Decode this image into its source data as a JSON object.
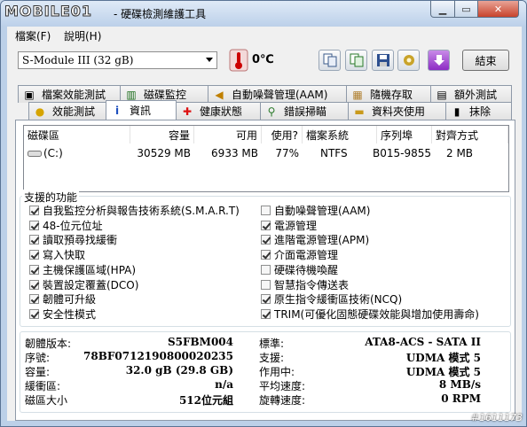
{
  "app": {
    "title": "- 硬碟檢測維護工具",
    "logo": "MOBILE01"
  },
  "menu": [
    "檔案(F)",
    "說明(H)"
  ],
  "toolbar": {
    "drive": "S-Module III        (32 gB)",
    "temperature": "0℃",
    "exit": "結束"
  },
  "tabs_top": [
    "檔案效能測試",
    "磁碟監控",
    "自動噪聲管理(AAM)",
    "隨機存取",
    "額外測試"
  ],
  "tabs_bottom": [
    "效能測試",
    "資訊",
    "健康狀態",
    "錯誤掃瞄",
    "資料夾使用",
    "抹除"
  ],
  "partition_table": {
    "headers": [
      "磁碟區",
      "容量",
      "可用",
      "使用?",
      "檔案系統",
      "序列埠",
      "對齊方式"
    ],
    "row": [
      "(C:)",
      "30529 MB",
      "6933 MB",
      "77%",
      "NTFS",
      "B015-9855",
      "2 MB"
    ]
  },
  "features": {
    "legend": "支援的功能",
    "left": [
      {
        "label": "自我監控分析與報告技術系統(S.M.A.R.T)",
        "checked": true
      },
      {
        "label": "48-位元位址",
        "checked": true
      },
      {
        "label": "讀取預尋找緩衝",
        "checked": true
      },
      {
        "label": "寫入快取",
        "checked": true
      },
      {
        "label": "主機保護區域(HPA)",
        "checked": true
      },
      {
        "label": "裝置設定覆蓋(DCO)",
        "checked": true
      },
      {
        "label": "韌體可升級",
        "checked": true
      },
      {
        "label": "安全性模式",
        "checked": true
      }
    ],
    "right": [
      {
        "label": "自動噪聲管理(AAM)",
        "checked": false
      },
      {
        "label": "電源管理",
        "checked": true
      },
      {
        "label": "進階電源管理(APM)",
        "checked": true
      },
      {
        "label": "介面電源管理",
        "checked": true
      },
      {
        "label": "硬碟待機喚醒",
        "checked": false
      },
      {
        "label": "智慧指令傳送表",
        "checked": false
      },
      {
        "label": "原生指令緩衝區技術(NCQ)",
        "checked": true
      },
      {
        "label": "TRIM(可優化固態硬碟效能與增加使用壽命)",
        "checked": true
      }
    ]
  },
  "info": {
    "left": [
      {
        "label": "韌體版本:",
        "value": "S5FBM004"
      },
      {
        "label": "序號:",
        "value": "78BF0712190800020235"
      },
      {
        "label": "容量:",
        "value": "32.0 gB (29.8 GB)"
      },
      {
        "label": "緩衝區:",
        "value": "n/a"
      },
      {
        "label": "磁區大小",
        "value": "512位元組"
      }
    ],
    "right": [
      {
        "label": "標準:",
        "value": "ATA8-ACS - SATA II"
      },
      {
        "label": "支援:",
        "value": "UDMA 模式 5"
      },
      {
        "label": "作用中:",
        "value": "UDMA 模式 5"
      },
      {
        "label": "平均速度:",
        "value": "8 MB/s"
      },
      {
        "label": "旋轉速度:",
        "value": "0 RPM"
      }
    ]
  },
  "watermark": "#1611173"
}
